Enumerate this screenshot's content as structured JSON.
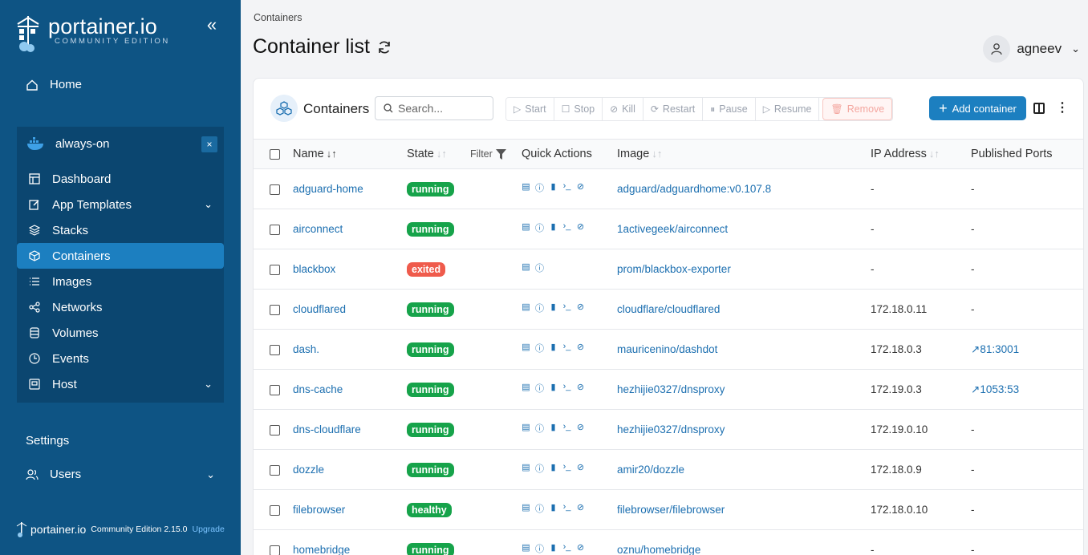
{
  "brand": {
    "name": "portainer.io",
    "edition": "COMMUNITY EDITION"
  },
  "sidebar": {
    "home": "Home",
    "environment": {
      "name": "always-on",
      "close": "×"
    },
    "env_items": [
      "Dashboard",
      "App Templates",
      "Stacks",
      "Containers",
      "Images",
      "Networks",
      "Volumes",
      "Events",
      "Host"
    ],
    "active_item": "Containers",
    "settings_heading": "Settings",
    "users": "Users"
  },
  "footer": {
    "name": "portainer.io",
    "edition": "Community Edition",
    "version": "2.15.0",
    "upgrade": "Upgrade"
  },
  "header": {
    "breadcrumb": "Containers",
    "title": "Container list",
    "user": "agneev"
  },
  "panel": {
    "title": "Containers",
    "search_placeholder": "Search...",
    "actions": [
      "Start",
      "Stop",
      "Kill",
      "Restart",
      "Pause",
      "Resume"
    ],
    "remove": "Remove",
    "add": "Add container"
  },
  "table": {
    "columns": {
      "name": "Name",
      "state": "State",
      "filter": "Filter",
      "quick_actions": "Quick Actions",
      "image": "Image",
      "ip": "IP Address",
      "ports": "Published Ports"
    },
    "rows": [
      {
        "name": "adguard-home",
        "state": "running",
        "image": "adguard/adguardhome:v0.107.8",
        "ip": "-",
        "ports": "-"
      },
      {
        "name": "airconnect",
        "state": "running",
        "image": "1activegeek/airconnect",
        "ip": "-",
        "ports": "-"
      },
      {
        "name": "blackbox",
        "state": "exited",
        "image": "prom/blackbox-exporter",
        "ip": "-",
        "ports": "-"
      },
      {
        "name": "cloudflared",
        "state": "running",
        "image": "cloudflare/cloudflared",
        "ip": "172.18.0.11",
        "ports": "-"
      },
      {
        "name": "dash.",
        "state": "running",
        "image": "mauricenino/dashdot",
        "ip": "172.18.0.3",
        "ports": "81:3001"
      },
      {
        "name": "dns-cache",
        "state": "running",
        "image": "hezhijie0327/dnsproxy",
        "ip": "172.19.0.3",
        "ports": "1053:53"
      },
      {
        "name": "dns-cloudflare",
        "state": "running",
        "image": "hezhijie0327/dnsproxy",
        "ip": "172.19.0.10",
        "ports": "-"
      },
      {
        "name": "dozzle",
        "state": "running",
        "image": "amir20/dozzle",
        "ip": "172.18.0.9",
        "ports": "-"
      },
      {
        "name": "filebrowser",
        "state": "healthy",
        "image": "filebrowser/filebrowser",
        "ip": "172.18.0.10",
        "ports": "-"
      },
      {
        "name": "homebridge",
        "state": "running",
        "image": "oznu/homebridge",
        "ip": "-",
        "ports": "-"
      }
    ]
  }
}
